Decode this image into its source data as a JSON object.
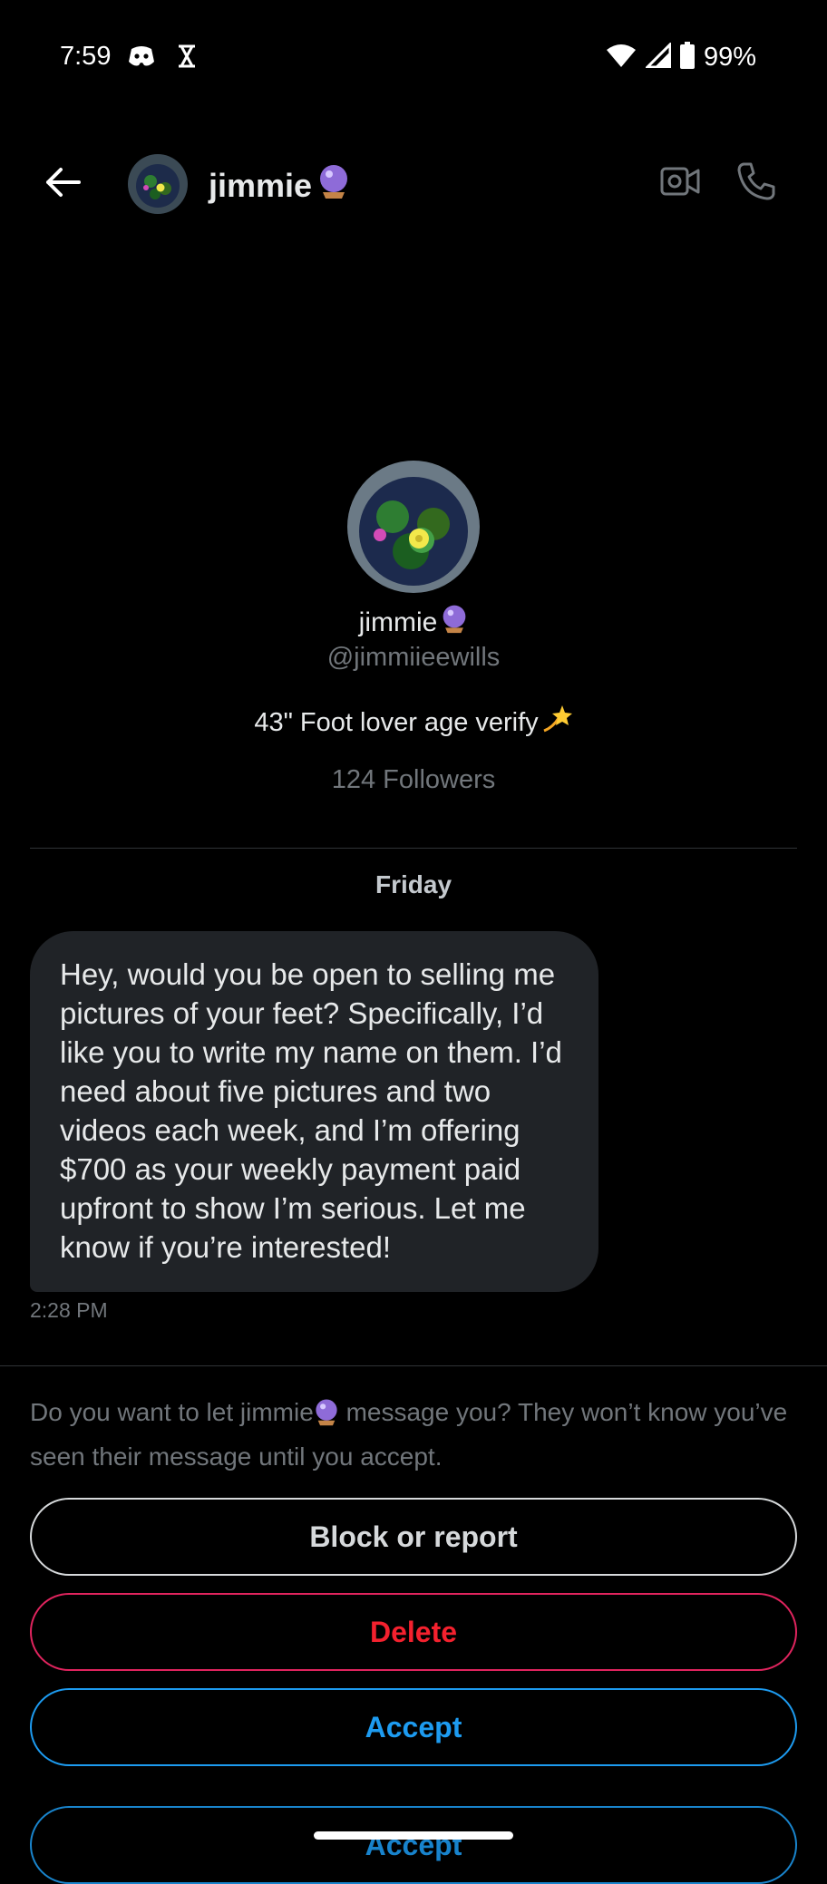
{
  "status_bar": {
    "time": "7:59",
    "battery": "99%"
  },
  "header": {
    "name": "jimmie",
    "name_emoji_icon": "crystal-ball-icon"
  },
  "profile": {
    "name": "jimmie",
    "handle": "@jimmiieewills",
    "bio": "43\" Foot lover age verify",
    "bio_emoji_icon": "dizzy-star-icon",
    "followers": "124 Followers"
  },
  "conversation": {
    "day": "Friday",
    "messages": [
      {
        "text": "Hey, would you be open to selling me pictures of your feet? Specifically, I’d like you to write my name on them. I’d need about five pictures and two videos each week, and I’m offering $700 as your weekly payment paid upfront to show I’m serious. Let me know if you’re interested!",
        "time": "2:28 PM"
      }
    ]
  },
  "request": {
    "prompt_before": "Do you want to let jimmie",
    "prompt_after": " message you? They won’t know you’ve seen their message until you accept.",
    "block_label": "Block or report",
    "delete_label": "Delete",
    "accept_label": "Accept",
    "ghost_label": "Accept"
  },
  "colors": {
    "background": "#000000",
    "bubble": "#202327",
    "accent_blue": "#1d9bf0",
    "danger_red": "#f4212e",
    "muted": "#71767b"
  }
}
